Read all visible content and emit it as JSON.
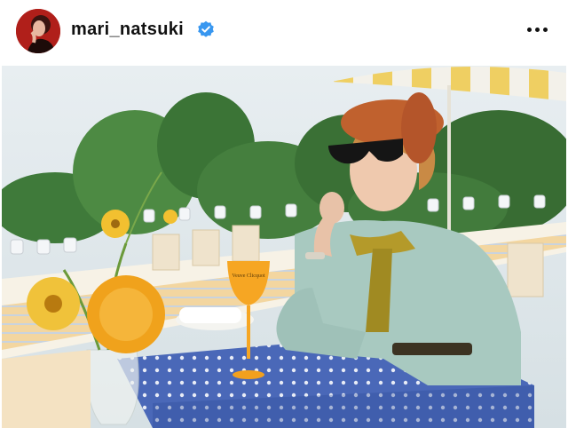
{
  "post": {
    "username": "mari_natsuki",
    "verified": true,
    "avatar_icon": "profile-avatar",
    "more_icon": "more-options-icon"
  },
  "photo": {
    "glass_label": "Veuve Clicquot"
  },
  "colors": {
    "verified_badge": "#3897f0",
    "avatar_bg": "#b8231d",
    "tablecloth": "#4a68b8",
    "shirt": "#a8c9c0",
    "beret": "#c0612e",
    "flowers": "#f0a21c",
    "glass": "#f6a623"
  }
}
